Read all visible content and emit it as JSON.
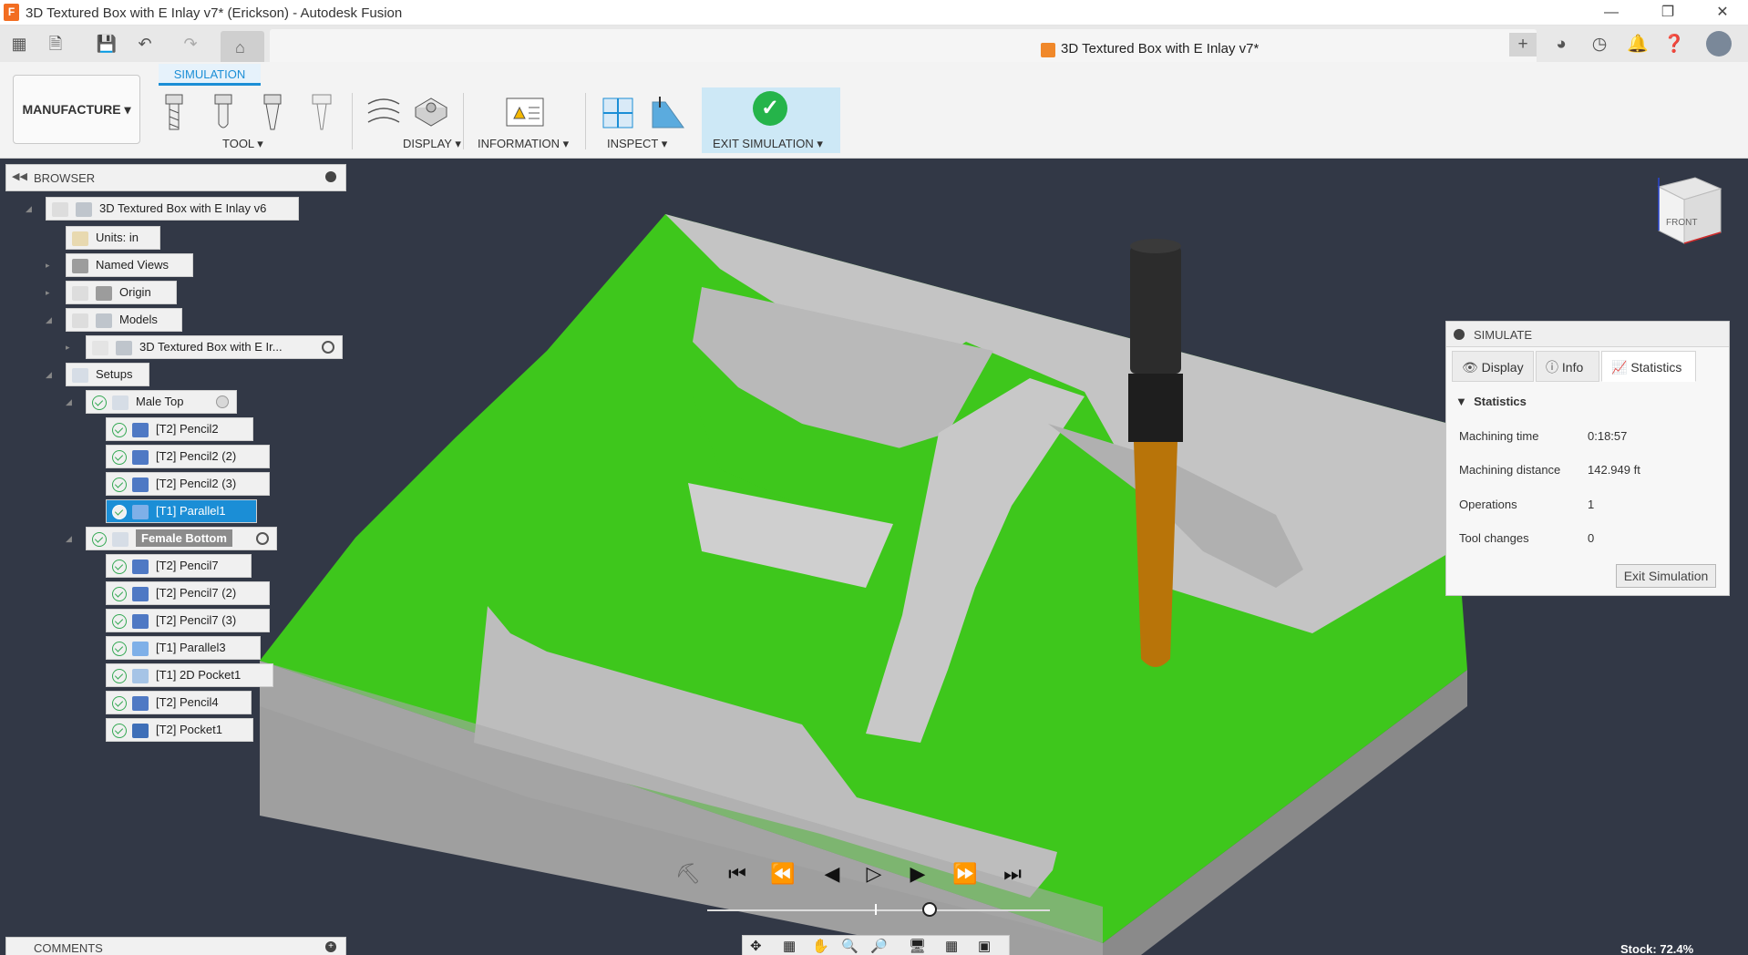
{
  "window": {
    "title": "3D Textured Box with E Inlay v7* (Erickson) - Autodesk Fusion",
    "logo_letter": "F"
  },
  "document_tab": {
    "label": "3D Textured Box with E Inlay v7*"
  },
  "toolbar": {
    "workspace": "MANUFACTURE",
    "active_tab": "SIMULATION",
    "groups": {
      "tool": "TOOL",
      "display": "DISPLAY",
      "information": "INFORMATION",
      "inspect": "INSPECT",
      "exit_simulation": "EXIT SIMULATION"
    }
  },
  "browser": {
    "title": "BROWSER",
    "root": "3D Textured Box with E Inlay v6",
    "units": "Units: in",
    "named_views": "Named Views",
    "origin": "Origin",
    "models": "Models",
    "model_item": "3D Textured Box with E Ir...",
    "setups": "Setups",
    "male_top": "Male Top",
    "male_ops": [
      "[T2] Pencil2",
      "[T2] Pencil2 (2)",
      "[T2] Pencil2 (3)",
      "[T1] Parallel1"
    ],
    "female_bottom": "Female Bottom",
    "female_ops": [
      "[T2] Pencil7",
      "[T2] Pencil7 (2)",
      "[T2] Pencil7 (3)",
      "[T1] Parallel3",
      "[T1] 2D Pocket1",
      "[T2] Pencil4",
      "[T2] Pocket1"
    ]
  },
  "simulate": {
    "title": "SIMULATE",
    "tabs": [
      "Display",
      "Info",
      "Statistics"
    ],
    "section": "Statistics",
    "stats": [
      {
        "label": "Machining time",
        "value": "0:18:57"
      },
      {
        "label": "Machining distance",
        "value": "142.949 ft"
      },
      {
        "label": "Operations",
        "value": "1"
      },
      {
        "label": "Tool changes",
        "value": "0"
      }
    ],
    "exit_button": "Exit Simulation"
  },
  "viewcube": {
    "face": "FRONT"
  },
  "playback": {
    "position": 0.65
  },
  "comments": {
    "label": "COMMENTS"
  },
  "status": {
    "stock": "Stock: 72.4%"
  },
  "colors": {
    "accent": "#1b8ed6",
    "stock_green": "#3ec71c",
    "part_gray": "#bdbdbd",
    "viewport_bg": "#323846",
    "tool_copper": "#b87409"
  }
}
